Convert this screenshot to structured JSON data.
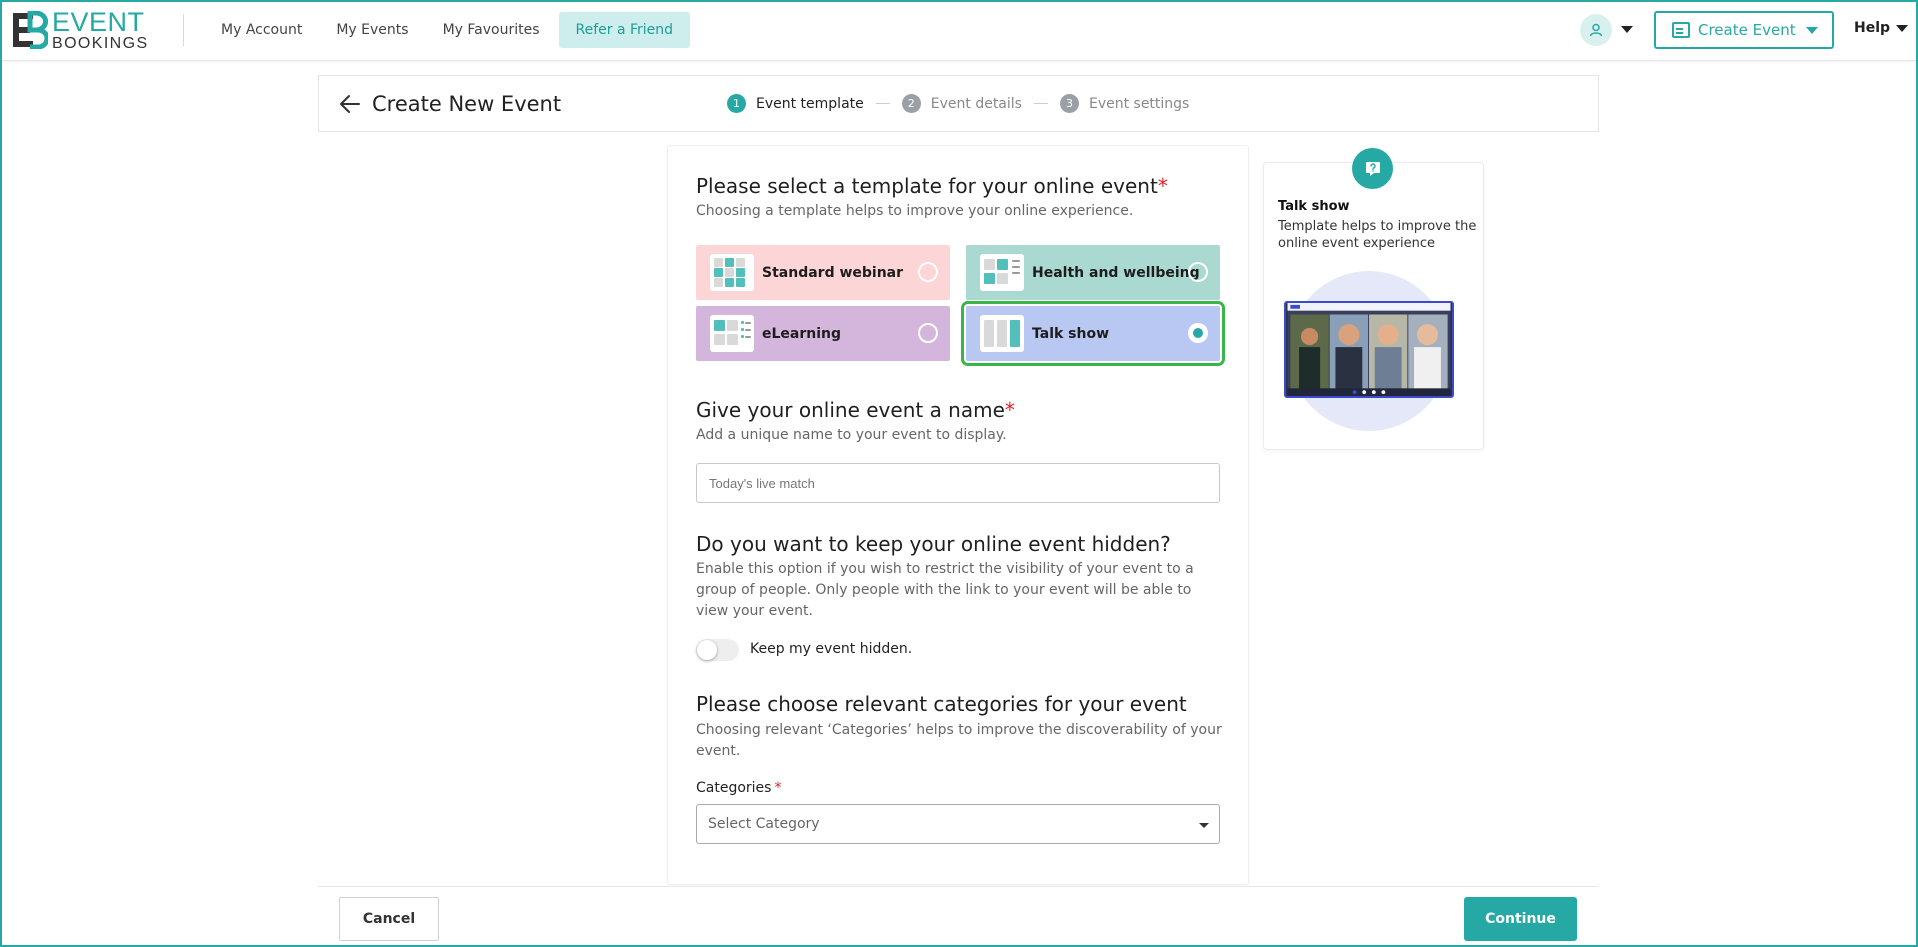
{
  "brand": {
    "line1": "EVENT",
    "line2": "BOOKINGS"
  },
  "nav": {
    "items": [
      {
        "label": "My Account"
      },
      {
        "label": "My Events"
      },
      {
        "label": "My Favourites"
      },
      {
        "label": "Refer a Friend"
      }
    ]
  },
  "header": {
    "create_event_label": "Create Event",
    "help_label": "Help"
  },
  "page": {
    "title": "Create New Event",
    "steps": [
      {
        "num": "1",
        "label": "Event template",
        "active": true
      },
      {
        "num": "2",
        "label": "Event details",
        "active": false
      },
      {
        "num": "3",
        "label": "Event settings",
        "active": false
      }
    ]
  },
  "template_section": {
    "title": "Please select a template for your online event",
    "required_mark": "*",
    "subtitle": "Choosing a template helps to improve your online experience.",
    "options": [
      {
        "label": "Standard webinar",
        "color": "#fcd5d6",
        "selected": false
      },
      {
        "label": "Health and wellbeing",
        "color": "#a9d9d1",
        "selected": false
      },
      {
        "label": "eLearning",
        "color": "#d4b6dd",
        "selected": false
      },
      {
        "label": "Talk show",
        "color": "#b9c8f3",
        "selected": true
      }
    ]
  },
  "name_section": {
    "title": "Give your online event a name",
    "required_mark": "*",
    "subtitle": "Add a unique name to your event to display.",
    "placeholder": "Today's live match"
  },
  "hidden_section": {
    "title": "Do you want to keep your online event hidden?",
    "subtitle": "Enable this option if you wish to restrict the visibility of your event to a group of people. Only people with the link to your event will be able to view your event.",
    "toggle_label": "Keep my event hidden.",
    "toggle_on": false
  },
  "category_section": {
    "title": "Please choose relevant categories for your event",
    "subtitle": "Choosing relevant ‘Categories’ helps to improve the discoverability of your event.",
    "field_label": "Categories",
    "required_mark": "*",
    "selected_value": "Select Category"
  },
  "preview": {
    "title": "Talk show",
    "description": "Template helps to improve the online event experience"
  },
  "footer": {
    "cancel_label": "Cancel",
    "continue_label": "Continue"
  },
  "colors": {
    "accent": "#26a9a4",
    "required": "#e02424",
    "selected_outline": "#3ab54a"
  }
}
